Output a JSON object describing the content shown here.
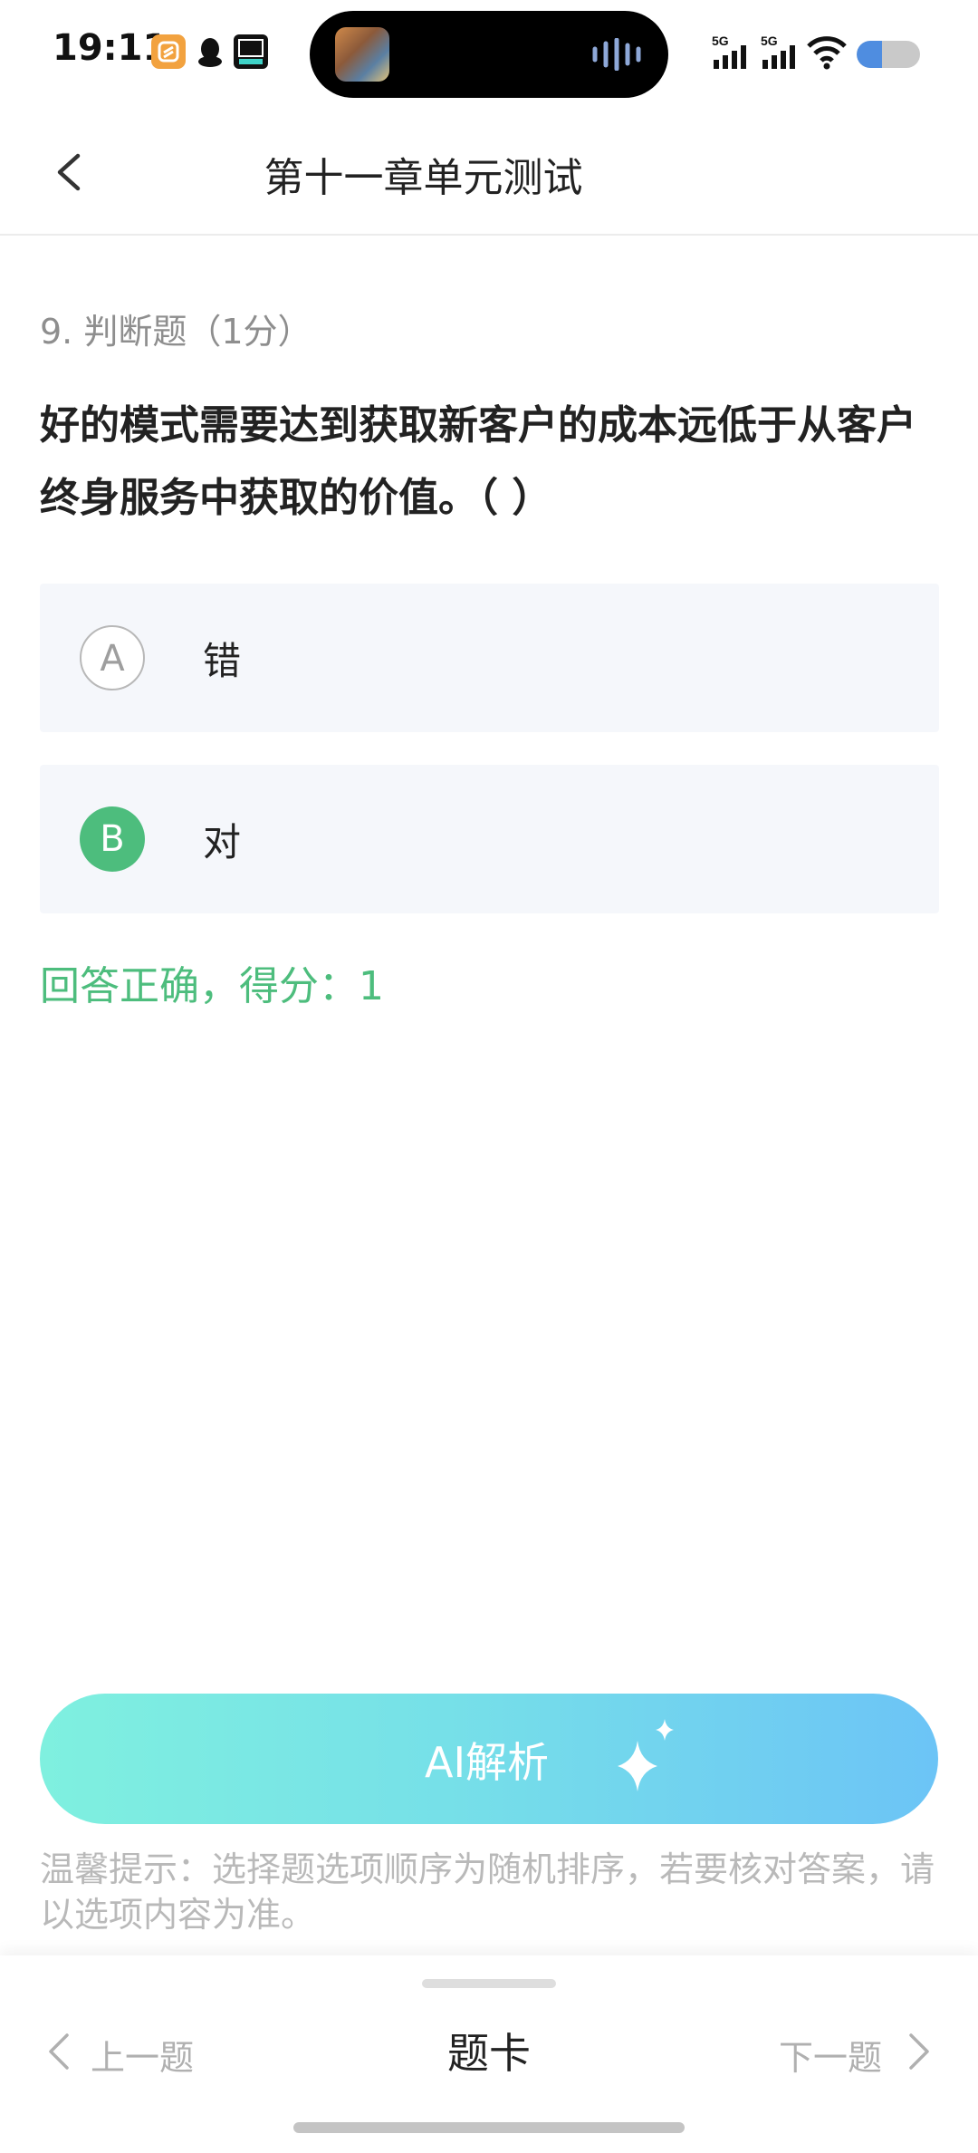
{
  "status_bar": {
    "time": "19:11",
    "notification_icons": [
      "taobao-app-icon",
      "qq-penguin-icon",
      "dewu-app-icon"
    ],
    "signal_labels": [
      "5G",
      "5G"
    ],
    "battery_color": "#4f8de0"
  },
  "nav": {
    "title": "第十一章单元测试"
  },
  "question": {
    "meta": "9. 判断题（1分）",
    "text": "好的模式需要达到获取新客户的成本远低于从客户终身服务中获取的价值。（ ）",
    "options": [
      {
        "letter": "A",
        "text": "错",
        "selected": false
      },
      {
        "letter": "B",
        "text": "对",
        "selected": true
      }
    ],
    "result": "回答正确，得分：1"
  },
  "ai_button": {
    "label": "AI解析",
    "icon": "sparkle-icon"
  },
  "tip": "温馨提示：选择题选项顺序为随机排序，若要核对答案，请以选项内容为准。",
  "bottom_bar": {
    "prev_label": "上一题",
    "card_label": "题卡",
    "next_label": "下一题"
  },
  "colors": {
    "correct_green": "#4dbd7d",
    "option_bg": "#f5f7fb",
    "ai_gradient_start": "#7ff0df",
    "ai_gradient_end": "#6cc4f6"
  }
}
